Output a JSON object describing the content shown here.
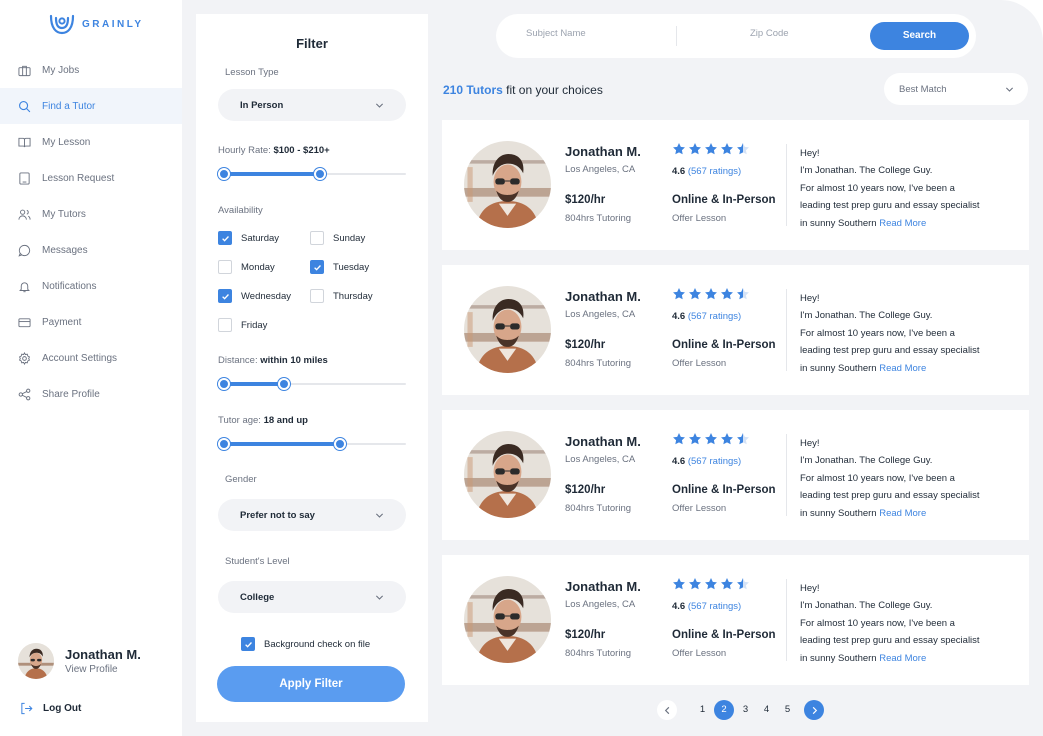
{
  "brand": {
    "name": "GRAINLY",
    "accent": "#3d84e0"
  },
  "sidebar": {
    "items": [
      {
        "label": "My Jobs",
        "icon": "briefcase-icon",
        "active": false
      },
      {
        "label": "Find a Tutor",
        "icon": "search-icon",
        "active": true
      },
      {
        "label": "My Lesson",
        "icon": "book-open-icon",
        "active": false
      },
      {
        "label": "Lesson Request",
        "icon": "tablet-icon",
        "active": false
      },
      {
        "label": "My Tutors",
        "icon": "users-icon",
        "active": false
      },
      {
        "label": "Messages",
        "icon": "message-icon",
        "active": false
      },
      {
        "label": "Notifications",
        "icon": "bell-icon",
        "active": false
      },
      {
        "label": "Payment",
        "icon": "credit-card-icon",
        "active": false
      },
      {
        "label": "Account Settings",
        "icon": "gear-icon",
        "active": false
      },
      {
        "label": "Share Profile",
        "icon": "share-icon",
        "active": false
      }
    ],
    "profile": {
      "name": "Jonathan M.",
      "link": "View Profile"
    },
    "logout": "Log Out"
  },
  "filter": {
    "title": "Filter",
    "lesson_type_label": "Lesson Type",
    "lesson_type_value": "In Person",
    "hourly_rate_label": "Hourly Rate:",
    "hourly_rate_value": "$100 - $210+",
    "hourly_rate_range": [
      0.0,
      0.53
    ],
    "availability_label": "Availability",
    "days": [
      {
        "label": "Saturday",
        "checked": true
      },
      {
        "label": "Sunday",
        "checked": false
      },
      {
        "label": "Monday",
        "checked": false
      },
      {
        "label": "Tuesday",
        "checked": true
      },
      {
        "label": "Wednesday",
        "checked": true
      },
      {
        "label": "Thursday",
        "checked": false
      },
      {
        "label": "Friday",
        "checked": false
      }
    ],
    "distance_label": "Distance:",
    "distance_value": "within 10 miles",
    "distance_range": [
      0.0,
      0.33
    ],
    "age_label": "Tutor age:",
    "age_value": "18 and up",
    "age_range": [
      0.0,
      0.64
    ],
    "gender_label": "Gender",
    "gender_value": "Prefer not to say",
    "level_label": "Student's Level",
    "level_value": "College",
    "background_check_label": "Background check on file",
    "background_check_checked": true,
    "apply_label": "Apply Filter"
  },
  "search": {
    "subject_placeholder": "Subject Name",
    "zip_placeholder": "Zip Code",
    "button_label": "Search"
  },
  "results": {
    "count": "210 Tutors",
    "suffix": "fit on your choices",
    "sort_value": "Best Match"
  },
  "tutors": [
    {
      "name": "Jonathan M.",
      "location": "Los Angeles, CA",
      "rate": "$120/hr",
      "hours": "804hrs Tutoring",
      "stars": 4.5,
      "rating": "4.6",
      "rating_count": "(567 ratings)",
      "mode": "Online & In-Person",
      "offer": "Offer Lesson",
      "bio": [
        "Hey!",
        "I'm Jonathan. The College Guy.",
        "For almost 10 years now, I've been a",
        "leading test prep guru and essay specialist",
        "in sunny Southern"
      ],
      "read_more": "Read More"
    },
    {
      "name": "Jonathan M.",
      "location": "Los Angeles, CA",
      "rate": "$120/hr",
      "hours": "804hrs Tutoring",
      "stars": 4.5,
      "rating": "4.6",
      "rating_count": "(567 ratings)",
      "mode": "Online & In-Person",
      "offer": "Offer Lesson",
      "bio": [
        "Hey!",
        "I'm Jonathan. The College Guy.",
        "For almost 10 years now, I've been a",
        "leading test prep guru and essay specialist",
        "in sunny Southern"
      ],
      "read_more": "Read More"
    },
    {
      "name": "Jonathan M.",
      "location": "Los Angeles, CA",
      "rate": "$120/hr",
      "hours": "804hrs Tutoring",
      "stars": 4.5,
      "rating": "4.6",
      "rating_count": "(567 ratings)",
      "mode": "Online & In-Person",
      "offer": "Offer Lesson",
      "bio": [
        "Hey!",
        "I'm Jonathan. The College Guy.",
        "For almost 10 years now, I've been a",
        "leading test prep guru and essay specialist",
        "in sunny Southern"
      ],
      "read_more": "Read More"
    },
    {
      "name": "Jonathan M.",
      "location": "Los Angeles, CA",
      "rate": "$120/hr",
      "hours": "804hrs Tutoring",
      "stars": 4.5,
      "rating": "4.6",
      "rating_count": "(567 ratings)",
      "mode": "Online & In-Person",
      "offer": "Offer Lesson",
      "bio": [
        "Hey!",
        "I'm Jonathan. The College Guy.",
        "For almost 10 years now, I've been a",
        "leading test prep guru and essay specialist",
        "in sunny Southern"
      ],
      "read_more": "Read More"
    }
  ],
  "pagination": {
    "pages": [
      "1",
      "2",
      "3",
      "4",
      "5"
    ],
    "current": "2"
  }
}
